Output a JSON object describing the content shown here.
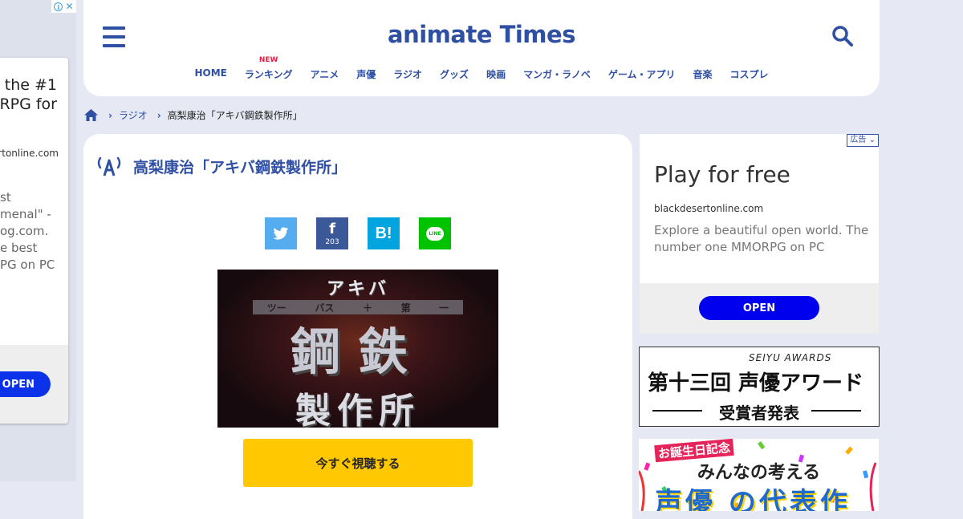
{
  "left_ad": {
    "headline_lines": [
      "the #1",
      "ORPG for"
    ],
    "domain": "ertonline.com",
    "description_lines": [
      "st",
      "menal\" -",
      "og.com.",
      "e best",
      "PG on PC"
    ],
    "cta": "OPEN"
  },
  "header": {
    "logo": "animate Times",
    "nav": [
      {
        "label": "HOME",
        "badge": ""
      },
      {
        "label": "ランキング",
        "badge": "NEW"
      },
      {
        "label": "アニメ",
        "badge": ""
      },
      {
        "label": "声優",
        "badge": ""
      },
      {
        "label": "ラジオ",
        "badge": ""
      },
      {
        "label": "グッズ",
        "badge": ""
      },
      {
        "label": "映画",
        "badge": ""
      },
      {
        "label": "マンガ・ラノベ",
        "badge": ""
      },
      {
        "label": "ゲーム・アプリ",
        "badge": ""
      },
      {
        "label": "音楽",
        "badge": ""
      },
      {
        "label": "コスプレ",
        "badge": ""
      }
    ]
  },
  "breadcrumb": {
    "items": [
      "ラジオ",
      "高梨康治「アキバ鋼鉄製作所」"
    ]
  },
  "article": {
    "title": "高梨康治「アキバ鋼鉄製作所」",
    "share": {
      "facebook_count": "203",
      "hatena": "B!",
      "line": "LINE"
    },
    "hero": {
      "top": "アキバ",
      "bar": [
        "ツー",
        "バス",
        "＋",
        "第",
        "一"
      ],
      "main": "鋼鉄",
      "bottom": "製作所"
    },
    "listen_button": "今すぐ視聴する"
  },
  "right_ad": {
    "tag": "広告",
    "headline": "Play for free",
    "domain": "blackdesertonline.com",
    "description": "Explore a beautiful open world. The number one MMORPG on PC",
    "cta": "OPEN"
  },
  "banner_seiyu": {
    "english": "SEIYU AWARDS",
    "title": "第十三回 声優アワード",
    "subtitle": "受賞者発表"
  },
  "banner_birthday": {
    "line1": "お誕生日記念",
    "line2": "みんなの考える",
    "line3": "声優 の代表作"
  },
  "colors": {
    "brand": "#2f4fa3",
    "accent_yellow": "#ffc800",
    "background": "#e6e9f3",
    "ad_cta": "#0000ee"
  }
}
